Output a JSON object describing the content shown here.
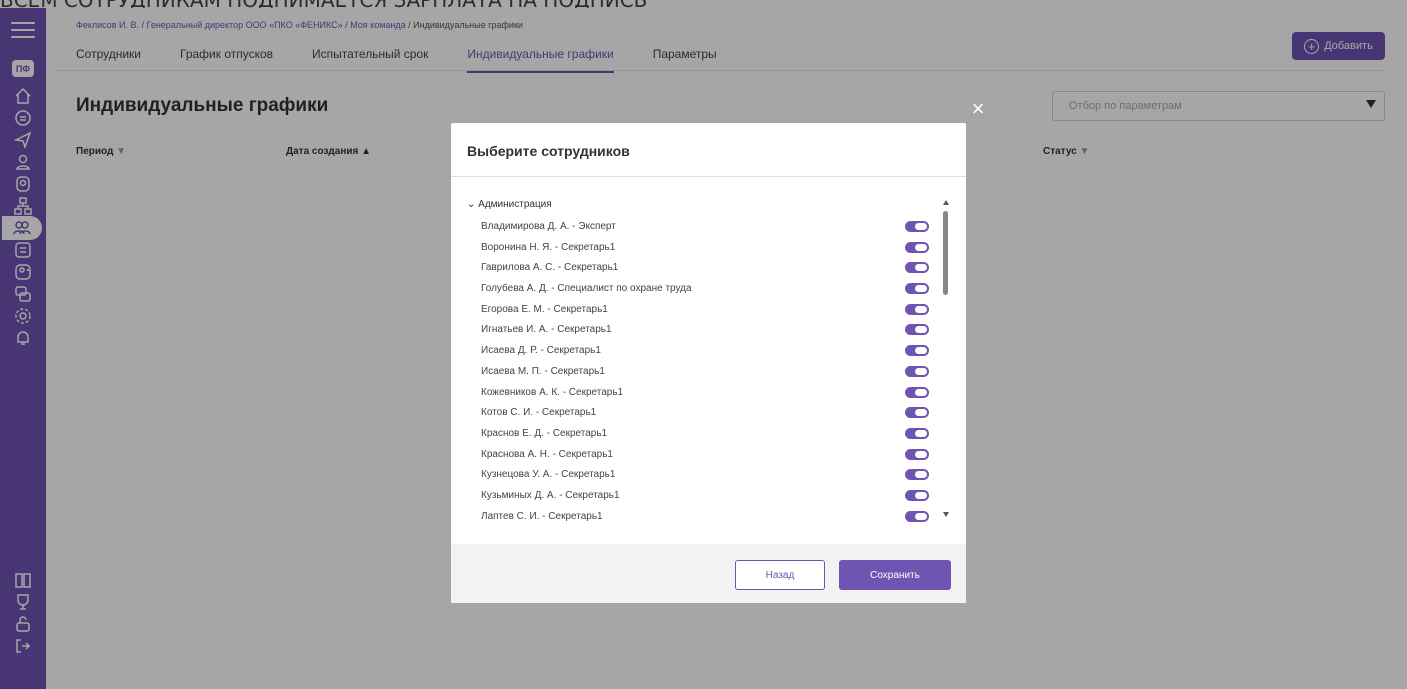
{
  "top_strip_text": "ВСЕМ СОТРУДНИКАМ ПОДНИМАЕТСЯ ЗАРПЛАТА НА ПОДПИСЬ",
  "logo": "ПФ",
  "breadcrumb": {
    "items": [
      "Феклисов И. В.",
      "Генеральный директор ООО «ПКО «ФЕНИКС»",
      "Моя команда"
    ],
    "current": "Индивидуальные графики",
    "separator": " / "
  },
  "tabs": [
    "Сотрудники",
    "График отпусков",
    "Испытательный срок",
    "Индивидуальные графики",
    "Параметры"
  ],
  "active_tab": "Индивидуальные графики",
  "add_button": "Добавить",
  "page_title": "Индивидуальные графики",
  "filter_placeholder": "Отбор по параметрам",
  "columns": {
    "period": "Период",
    "period_sort": "▼",
    "created": "Дата создания",
    "created_sort": "▲",
    "status": "Статус",
    "status_sort": "▼"
  },
  "modal": {
    "title": "Выберите сотрудников",
    "group": "Администрация",
    "employees": [
      "Владимирова Д. А. - Эксперт",
      "Воронина Н. Я. - Секретарь1",
      "Гаврилова А. С. - Секретарь1",
      "Голубева А. Д. - Специалист по охране труда",
      "Егорова Е. М. - Секретарь1",
      "Игнатьев И. А. - Секретарь1",
      "Исаева Д. Р. - Секретарь1",
      "Исаева М. П. - Секретарь1",
      "Кожевников А. К. - Секретарь1",
      "Котов С. И. - Секретарь1",
      "Краснов Е. Д. - Секретарь1",
      "Краснова А. Н. - Секретарь1",
      "Кузнецова У. А. - Секретарь1",
      "Кузьминых Д. А. - Секретарь1",
      "Лаптев С. И. - Секретарь1"
    ],
    "back_button": "Назад",
    "save_button": "Сохранить"
  },
  "colors": {
    "accent": "#6f54b2"
  },
  "sidebar_icons": [
    "home-icon",
    "document-icon",
    "send-icon",
    "user-icon",
    "badge-icon",
    "org-chart-icon",
    "team-icon",
    "calendar-icon",
    "add-user-icon",
    "chat-icon",
    "gear-icon",
    "bell-icon",
    "book-icon",
    "trophy-icon",
    "lock-icon",
    "logout-icon"
  ]
}
